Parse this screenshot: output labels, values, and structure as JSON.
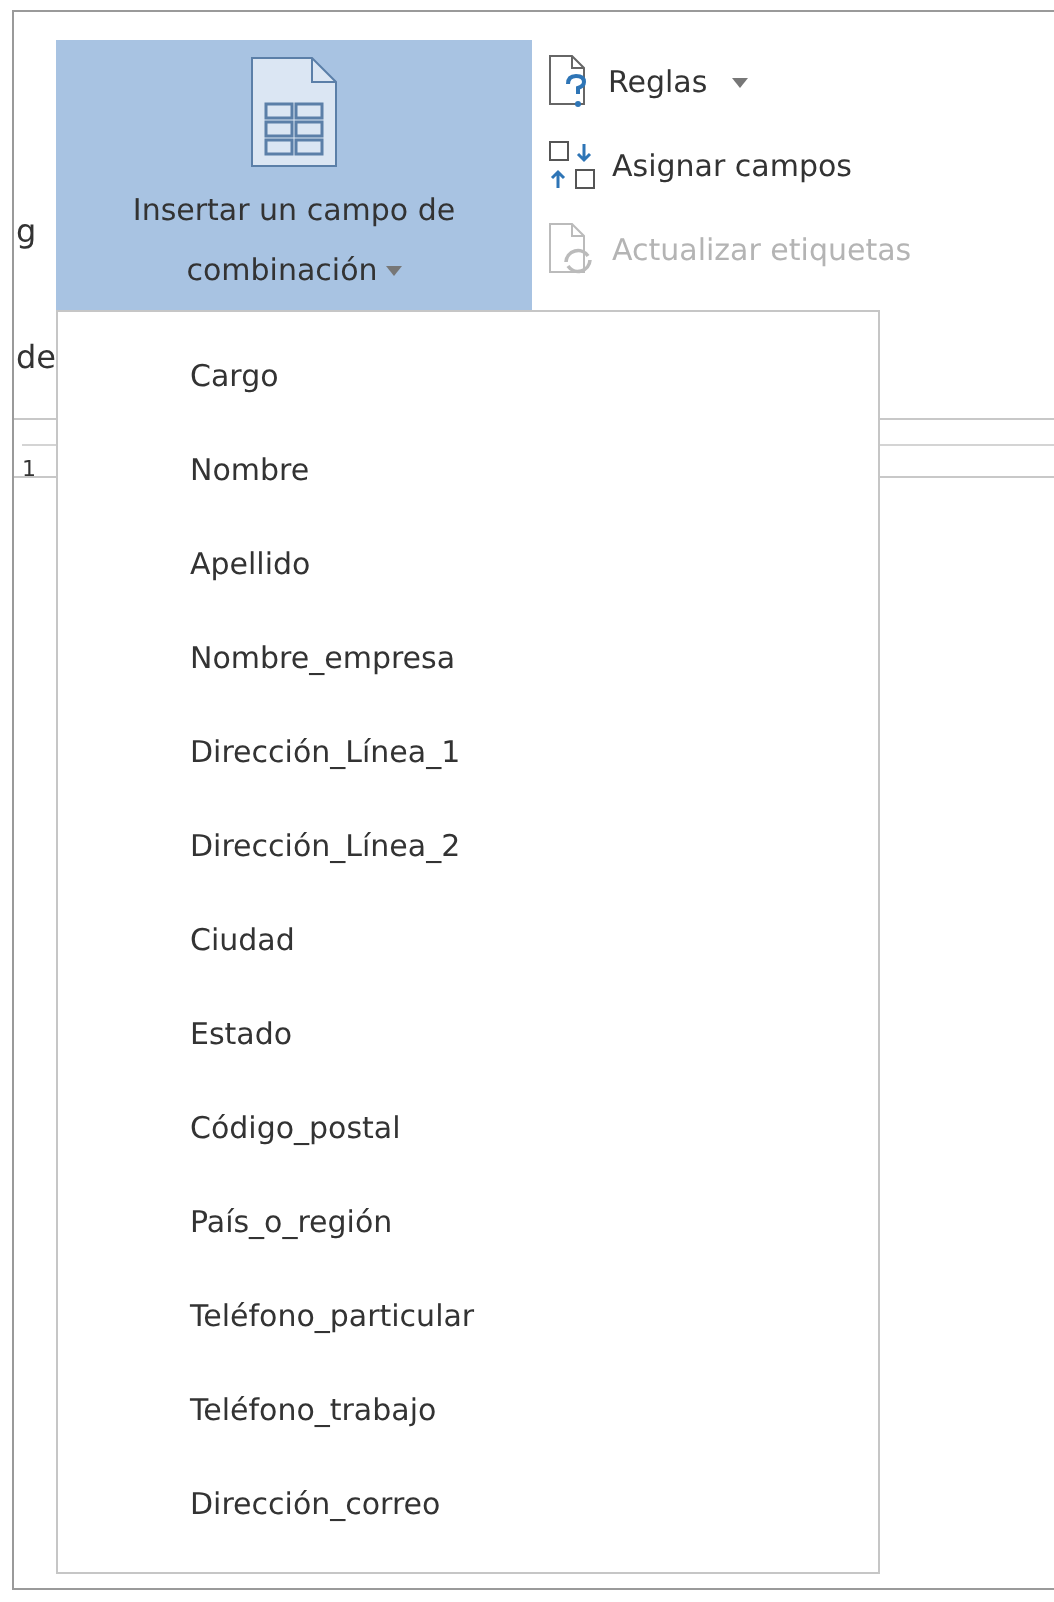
{
  "ribbon": {
    "cut_labels": [
      "g",
      "de"
    ],
    "insert_field_button": {
      "label_line_1": "Insertar un campo de",
      "label_line_2": "combinación",
      "pressed": true
    },
    "commands": [
      {
        "kind": "rules",
        "label": "Reglas",
        "has_dropdown": true,
        "disabled": false
      },
      {
        "kind": "match",
        "label": "Asignar campos",
        "has_dropdown": false,
        "disabled": false
      },
      {
        "kind": "update",
        "label": "Actualizar etiquetas",
        "has_dropdown": false,
        "disabled": true
      }
    ]
  },
  "ruler": {
    "mark": "1"
  },
  "menu": {
    "items": [
      "Cargo",
      "Nombre",
      "Apellido",
      "Nombre_empresa",
      "Dirección_Línea_1",
      "Dirección_Línea_2",
      "Ciudad",
      "Estado",
      "Código_postal",
      "País_o_región",
      "Teléfono_particular",
      "Teléfono_trabajo",
      "Dirección_correo"
    ]
  }
}
